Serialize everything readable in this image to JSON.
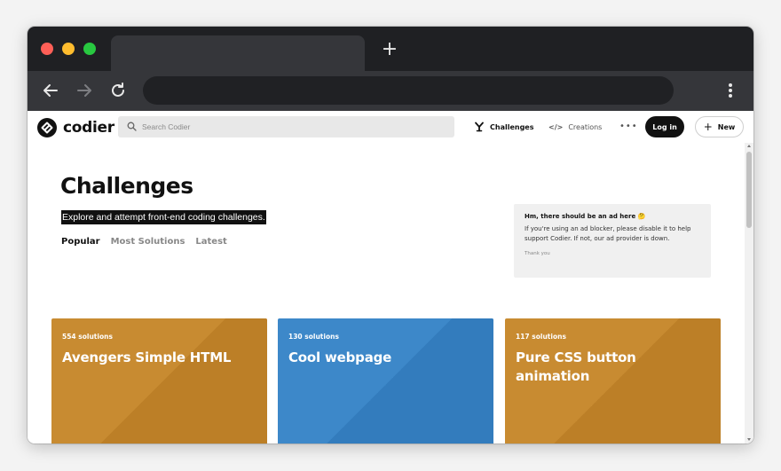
{
  "browser": {
    "new_tab_symbol": "+",
    "dot_colors": [
      "#ff5f57",
      "#febc2e",
      "#28c840"
    ]
  },
  "site": {
    "logo_text": "codier",
    "search_placeholder": "Search Codier",
    "nav": {
      "challenges_label": "Challenges",
      "creations_label": "Creations",
      "more_label": "•••",
      "login_label": "Log in",
      "new_label": "New"
    }
  },
  "hero": {
    "title": "Challenges",
    "subtitle": "Explore and attempt front-end coding challenges.",
    "filters": [
      "Popular",
      "Most Solutions",
      "Latest"
    ],
    "active_filter": "Popular"
  },
  "ad": {
    "title": "Hm, there should be an ad here 🤔",
    "body": "If you're using an ad blocker, please disable it to help support Codier. If not, our ad provider is down.",
    "footer": "Thank you"
  },
  "cards": [
    {
      "count": "554 solutions",
      "title": "Avengers Simple HTML",
      "color": "#c88b31",
      "shade": "#bc7f27"
    },
    {
      "count": "130 solutions",
      "title": "Cool webpage",
      "color": "#3d88c9",
      "shade": "#337cbd"
    },
    {
      "count": "117 solutions",
      "title": "Pure CSS button animation",
      "color": "#c88b31",
      "shade": "#bc7f27"
    }
  ]
}
